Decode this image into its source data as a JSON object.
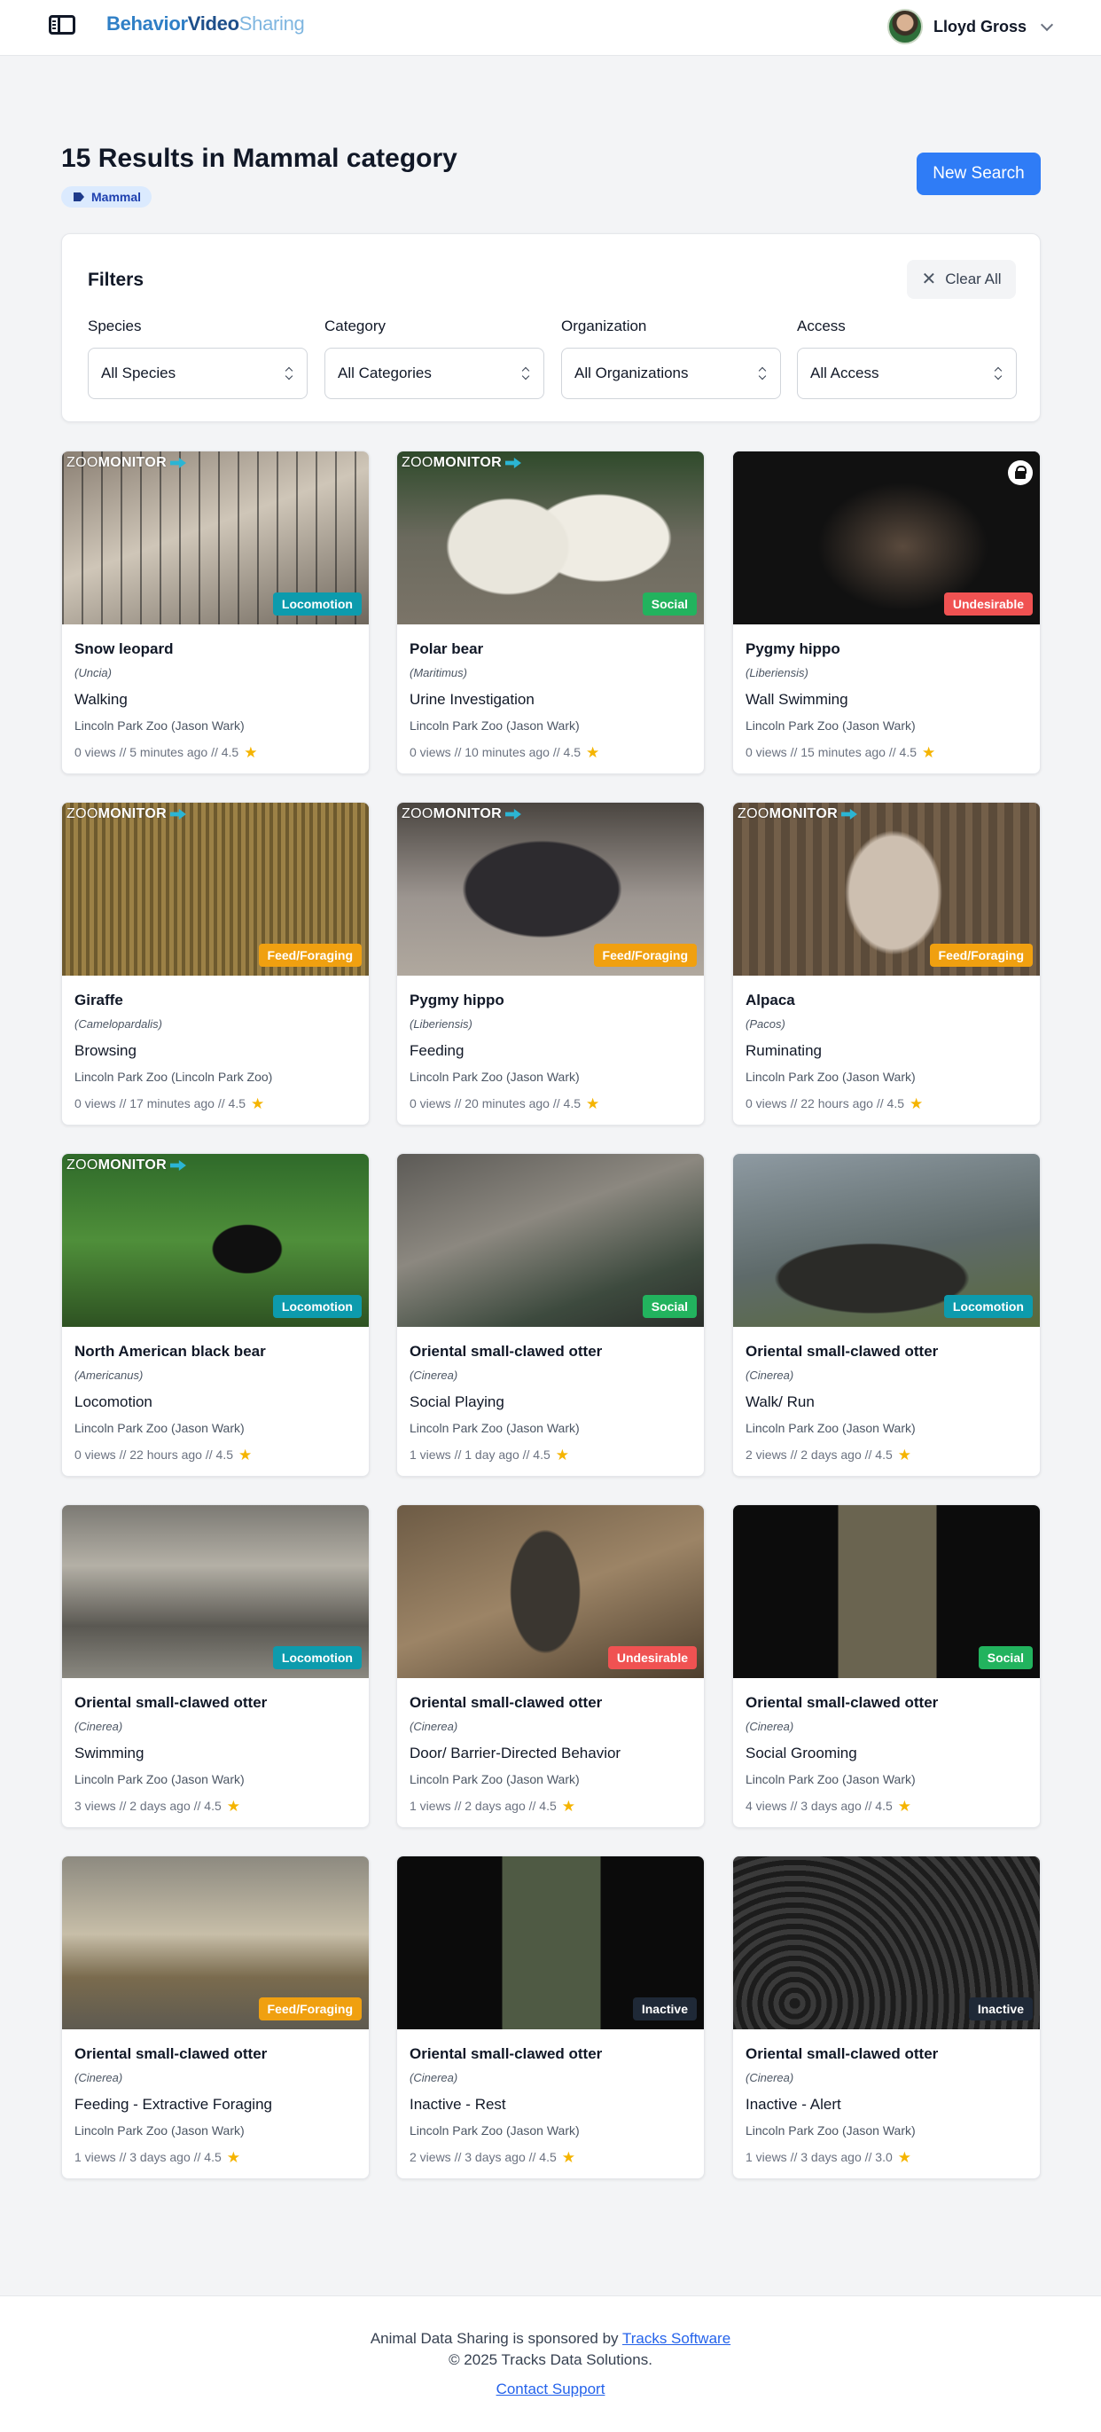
{
  "header": {
    "brand_part1": "Behavior",
    "brand_part2": "Video",
    "brand_part3": "Sharing",
    "user_name": "Lloyd Gross"
  },
  "results": {
    "title": "15 Results in Mammal category",
    "category_badge": "Mammal",
    "new_search_label": "New Search"
  },
  "filters": {
    "title": "Filters",
    "clear_all_label": "Clear All",
    "fields": [
      {
        "label": "Species",
        "value": "All Species"
      },
      {
        "label": "Category",
        "value": "All Categories"
      },
      {
        "label": "Organization",
        "value": "All Organizations"
      },
      {
        "label": "Access",
        "value": "All Access"
      }
    ]
  },
  "zoomonitor_logo": {
    "zoo": "ZOO",
    "monitor": "MONITOR"
  },
  "badge_colors": {
    "Locomotion": "#0d9bad",
    "Social": "#22b35e",
    "Undesirable": "#f05252",
    "Feed/Foraging": "#f0a010",
    "Inactive": "#1f2937"
  },
  "videos": [
    {
      "species": "Snow leopard",
      "scientific": "(Uncia)",
      "behavior": "Walking",
      "organization": "Lincoln Park Zoo (Jason Wark)",
      "meta": "0 views // 5 minutes ago // 4.5",
      "badge": "Locomotion",
      "logo": true,
      "locked": false
    },
    {
      "species": "Polar bear",
      "scientific": "(Maritimus)",
      "behavior": "Urine Investigation",
      "organization": "Lincoln Park Zoo (Jason Wark)",
      "meta": "0 views // 10 minutes ago // 4.5",
      "badge": "Social",
      "logo": true,
      "locked": false
    },
    {
      "species": "Pygmy hippo",
      "scientific": "(Liberiensis)",
      "behavior": "Wall Swimming",
      "organization": "Lincoln Park Zoo (Jason Wark)",
      "meta": "0 views // 15 minutes ago // 4.5",
      "badge": "Undesirable",
      "logo": false,
      "locked": true
    },
    {
      "species": "Giraffe",
      "scientific": "(Camelopardalis)",
      "behavior": "Browsing",
      "organization": "Lincoln Park Zoo (Lincoln Park Zoo)",
      "meta": "0 views // 17 minutes ago // 4.5",
      "badge": "Feed/Foraging",
      "logo": true,
      "locked": false
    },
    {
      "species": "Pygmy hippo",
      "scientific": "(Liberiensis)",
      "behavior": "Feeding",
      "organization": "Lincoln Park Zoo (Jason Wark)",
      "meta": "0 views // 20 minutes ago // 4.5",
      "badge": "Feed/Foraging",
      "logo": true,
      "locked": false
    },
    {
      "species": "Alpaca",
      "scientific": "(Pacos)",
      "behavior": "Ruminating",
      "organization": "Lincoln Park Zoo (Jason Wark)",
      "meta": "0 views // 22 hours ago // 4.5",
      "badge": "Feed/Foraging",
      "logo": true,
      "locked": false
    },
    {
      "species": "North American black bear",
      "scientific": "(Americanus)",
      "behavior": "Locomotion",
      "organization": "Lincoln Park Zoo (Jason Wark)",
      "meta": "0 views // 22 hours ago // 4.5",
      "badge": "Locomotion",
      "logo": true,
      "locked": false
    },
    {
      "species": "Oriental small-clawed otter",
      "scientific": "(Cinerea)",
      "behavior": "Social Playing",
      "organization": "Lincoln Park Zoo (Jason Wark)",
      "meta": "1 views // 1 day ago // 4.5",
      "badge": "Social",
      "logo": false,
      "locked": false
    },
    {
      "species": "Oriental small-clawed otter",
      "scientific": "(Cinerea)",
      "behavior": "Walk/ Run",
      "organization": "Lincoln Park Zoo (Jason Wark)",
      "meta": "2 views // 2 days ago // 4.5",
      "badge": "Locomotion",
      "logo": false,
      "locked": false
    },
    {
      "species": "Oriental small-clawed otter",
      "scientific": "(Cinerea)",
      "behavior": "Swimming",
      "organization": "Lincoln Park Zoo (Jason Wark)",
      "meta": "3 views // 2 days ago // 4.5",
      "badge": "Locomotion",
      "logo": false,
      "locked": false
    },
    {
      "species": "Oriental small-clawed otter",
      "scientific": "(Cinerea)",
      "behavior": "Door/ Barrier-Directed Behavior",
      "organization": "Lincoln Park Zoo (Jason Wark)",
      "meta": "1 views // 2 days ago // 4.5",
      "badge": "Undesirable",
      "logo": false,
      "locked": false
    },
    {
      "species": "Oriental small-clawed otter",
      "scientific": "(Cinerea)",
      "behavior": "Social Grooming",
      "organization": "Lincoln Park Zoo (Jason Wark)",
      "meta": "4 views // 3 days ago // 4.5",
      "badge": "Social",
      "logo": false,
      "locked": false
    },
    {
      "species": "Oriental small-clawed otter",
      "scientific": "(Cinerea)",
      "behavior": "Feeding - Extractive Foraging",
      "organization": "Lincoln Park Zoo (Jason Wark)",
      "meta": "1 views // 3 days ago // 4.5",
      "badge": "Feed/Foraging",
      "logo": false,
      "locked": false
    },
    {
      "species": "Oriental small-clawed otter",
      "scientific": "(Cinerea)",
      "behavior": "Inactive - Rest",
      "organization": "Lincoln Park Zoo (Jason Wark)",
      "meta": "2 views // 3 days ago // 4.5",
      "badge": "Inactive",
      "logo": false,
      "locked": false
    },
    {
      "species": "Oriental small-clawed otter",
      "scientific": "(Cinerea)",
      "behavior": "Inactive - Alert",
      "organization": "Lincoln Park Zoo (Jason Wark)",
      "meta": "1 views // 3 days ago // 3.0",
      "badge": "Inactive",
      "logo": false,
      "locked": false
    }
  ],
  "footer": {
    "sponsor_text": "Animal Data Sharing is sponsored by",
    "sponsor_link": "Tracks Software",
    "copyright": "© 2025 Tracks Data Solutions.",
    "support_link": "Contact Support"
  }
}
